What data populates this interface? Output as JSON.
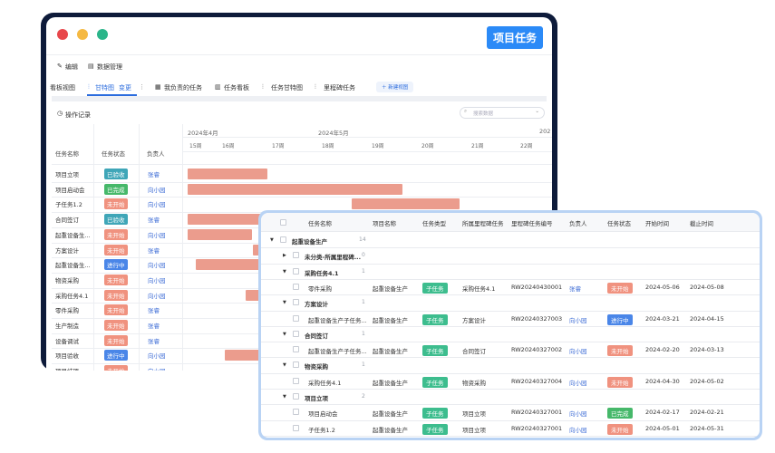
{
  "window": {
    "controls": {
      "close": "#e8474b",
      "minimize": "#f5b942",
      "maximize": "#2bb58a"
    },
    "brand": "项目任务"
  },
  "menu": {
    "edit": "编辑",
    "data_manage": "数据管理"
  },
  "tabs": [
    {
      "label": "看板视图"
    },
    {
      "label": "甘特图"
    },
    {
      "label": "变更"
    },
    {
      "label": "我负责的任务"
    },
    {
      "label": "任务看板"
    },
    {
      "label": "任务甘特图"
    },
    {
      "label": "里程碑任务"
    }
  ],
  "new_view": "新建视图",
  "op_log": "操作记录",
  "search_placeholder": "搜索数据",
  "gantt": {
    "headers": {
      "name": "任务名称",
      "status": "任务状态",
      "owner": "负责人"
    },
    "months": [
      "2024年4月",
      "2024年5月",
      "202"
    ],
    "weeks": [
      "15周",
      "16周",
      "17周",
      "18周",
      "19周",
      "20周",
      "21周",
      "22周"
    ],
    "rows": [
      {
        "name": "项目立项",
        "status": "已验收",
        "owner": "张睿"
      },
      {
        "name": "项目启动会",
        "status": "已完成",
        "owner": "向小园"
      },
      {
        "name": "子任务1.2",
        "status": "未开始",
        "owner": "向小园"
      },
      {
        "name": "合同签订",
        "status": "已验收",
        "owner": "张睿"
      },
      {
        "name": "起重设备生...",
        "status": "未开始",
        "owner": "向小园"
      },
      {
        "name": "方案设计",
        "status": "未开始",
        "owner": "张睿"
      },
      {
        "name": "起重设备生...",
        "status": "进行中",
        "owner": "向小园"
      },
      {
        "name": "物资采购",
        "status": "未开始",
        "owner": "向小园"
      },
      {
        "name": "采购任务4.1",
        "status": "未开始",
        "owner": "向小园"
      },
      {
        "name": "零件采购",
        "status": "未开始",
        "owner": "张睿"
      },
      {
        "name": "生产制造",
        "status": "未开始",
        "owner": "张睿"
      },
      {
        "name": "设备调试",
        "status": "未开始",
        "owner": "张睿"
      },
      {
        "name": "项目验收",
        "status": "进行中",
        "owner": "向小园"
      },
      {
        "name": "项目结项",
        "status": "未开始",
        "owner": "向小园"
      }
    ]
  },
  "table": {
    "headers": [
      "任务名称",
      "项目名称",
      "任务类型",
      "所属里程碑任务",
      "里程碑任务编号",
      "负责人",
      "任务状态",
      "开始时间",
      "截止时间"
    ],
    "rows": [
      {
        "kind": "group",
        "level": 0,
        "name": "起重设备生产",
        "count": "14"
      },
      {
        "kind": "group",
        "level": 1,
        "name": "未分类-所属里程碑...",
        "count": "0"
      },
      {
        "kind": "group",
        "level": 1,
        "name": "采购任务4.1",
        "count": "1"
      },
      {
        "kind": "item",
        "name": "零件采购",
        "project": "起重设备生产",
        "type": "子任务",
        "milestone": "采购任务4.1",
        "code": "RW20240430001",
        "owner": "张睿",
        "status": "未开始",
        "start": "2024-05-06",
        "end": "2024-05-08"
      },
      {
        "kind": "group",
        "level": 1,
        "name": "方案设计",
        "count": "1"
      },
      {
        "kind": "item",
        "name": "起重设备生产子任务...",
        "project": "起重设备生产",
        "type": "子任务",
        "milestone": "方案设计",
        "code": "RW20240327003",
        "owner": "向小园",
        "status": "进行中",
        "start": "2024-03-21",
        "end": "2024-04-15"
      },
      {
        "kind": "group",
        "level": 1,
        "name": "合同签订",
        "count": "1"
      },
      {
        "kind": "item",
        "name": "起重设备生产子任务...",
        "project": "起重设备生产",
        "type": "子任务",
        "milestone": "合同签订",
        "code": "RW20240327002",
        "owner": "向小园",
        "status": "未开始",
        "start": "2024-02-20",
        "end": "2024-03-13"
      },
      {
        "kind": "group",
        "level": 1,
        "name": "物资采购",
        "count": "1"
      },
      {
        "kind": "item",
        "name": "采购任务4.1",
        "project": "起重设备生产",
        "type": "子任务",
        "milestone": "物资采购",
        "code": "RW20240327004",
        "owner": "向小园",
        "status": "未开始",
        "start": "2024-04-30",
        "end": "2024-05-02"
      },
      {
        "kind": "group",
        "level": 1,
        "name": "项目立项",
        "count": "2"
      },
      {
        "kind": "item",
        "name": "项目启动会",
        "project": "起重设备生产",
        "type": "子任务",
        "milestone": "项目立项",
        "code": "RW20240327001",
        "owner": "向小园",
        "status": "已完成",
        "start": "2024-02-17",
        "end": "2024-02-21"
      },
      {
        "kind": "item",
        "name": "子任务1.2",
        "project": "起重设备生产",
        "type": "子任务",
        "milestone": "项目立项",
        "code": "RW20240327001",
        "owner": "向小园",
        "status": "未开始",
        "start": "2024-05-01",
        "end": "2024-05-31"
      }
    ]
  },
  "colors": {
    "accent": "#2b8af7",
    "status_accepted": "#3fa6b8",
    "status_done": "#46b86a",
    "status_todo": "#f0927f",
    "status_doing": "#4a86e8",
    "subtask": "#3dbd8e",
    "gantt_bar": "#eb9c8d"
  }
}
